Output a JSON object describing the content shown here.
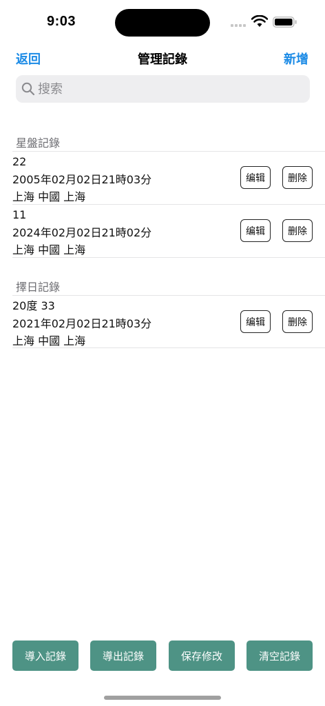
{
  "status_bar": {
    "time": "9:03"
  },
  "nav": {
    "back_label": "返回",
    "title": "管理記錄",
    "add_label": "新增"
  },
  "search": {
    "placeholder": "搜索",
    "value": ""
  },
  "sections": [
    {
      "header": "星盤記錄",
      "records": [
        {
          "name": "22",
          "datetime": "2005年02月02日21時03分",
          "location": "上海 中國 上海",
          "edit_label": "编辑",
          "delete_label": "删除"
        },
        {
          "name": "11",
          "datetime": "2024年02月02日21時02分",
          "location": "上海 中國 上海",
          "edit_label": "编辑",
          "delete_label": "删除"
        }
      ]
    },
    {
      "header": "擇日記錄",
      "records": [
        {
          "name": "20度 33",
          "datetime": "2021年02月02日21時03分",
          "location": "上海 中國 上海",
          "edit_label": "编辑",
          "delete_label": "删除"
        }
      ]
    }
  ],
  "toolbar": {
    "import_label": "導入記錄",
    "export_label": "導出記錄",
    "save_label": "保存修改",
    "clear_label": "清空記錄"
  },
  "colors": {
    "accent": "#1a8ae6",
    "toolbar_button": "#4e9385",
    "search_bg": "#eeeef0"
  }
}
